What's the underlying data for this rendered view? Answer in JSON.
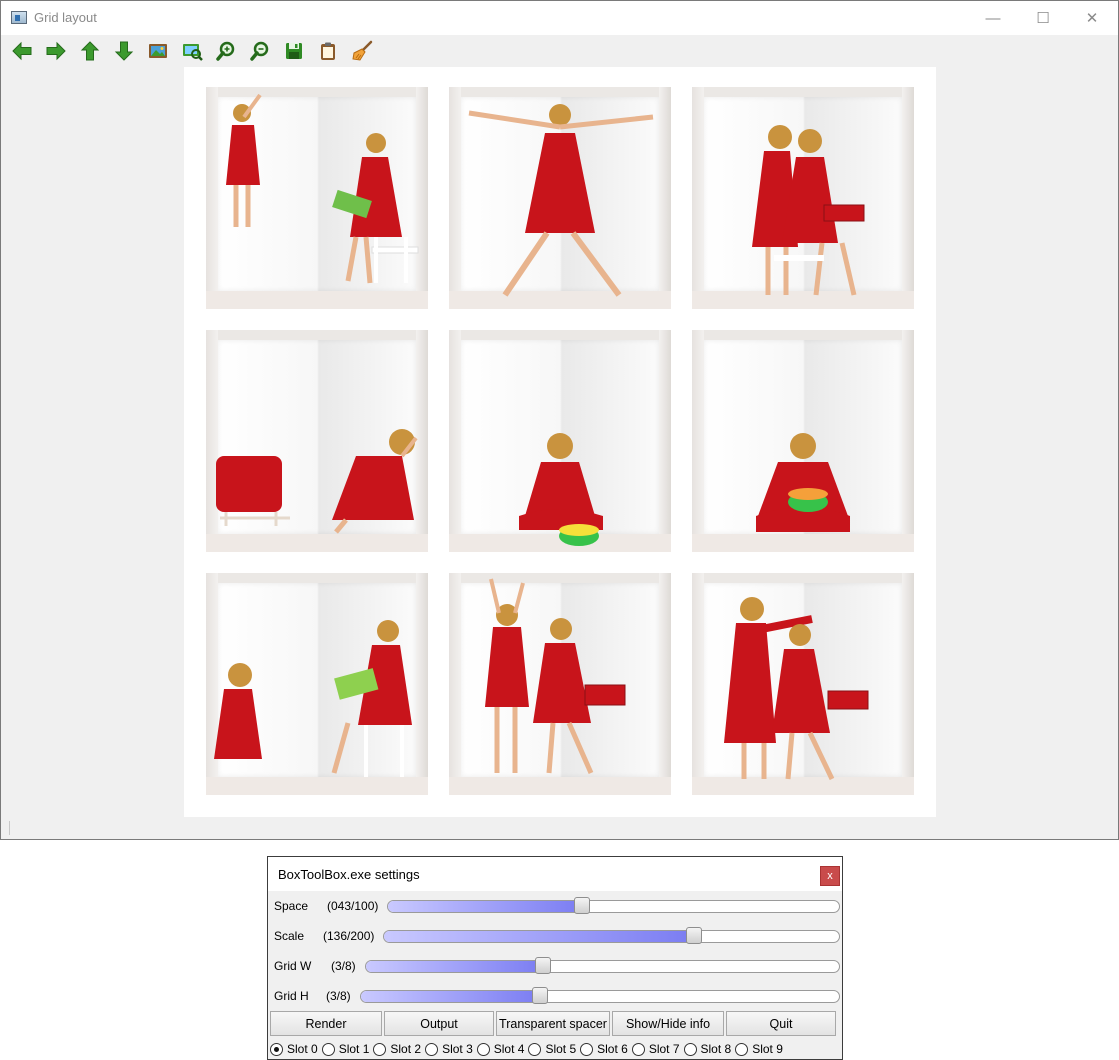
{
  "window": {
    "title": "Grid layout",
    "controls": {
      "minimize": "—",
      "maximize": "☐",
      "close": "✕"
    }
  },
  "toolbar": {
    "items": [
      {
        "name": "arrow-left-icon"
      },
      {
        "name": "arrow-right-icon"
      },
      {
        "name": "arrow-up-icon"
      },
      {
        "name": "arrow-down-icon"
      },
      {
        "name": "picture-icon"
      },
      {
        "name": "fit-picture-icon"
      },
      {
        "name": "zoom-in-icon"
      },
      {
        "name": "zoom-out-icon"
      },
      {
        "name": "save-icon"
      },
      {
        "name": "clipboard-icon"
      },
      {
        "name": "broom-icon"
      }
    ],
    "icon_color": "#3c9a2e"
  },
  "grid": {
    "rows": 3,
    "cols": 3,
    "cells": [
      {
        "name": "photo-girl-reaching-and-girl-reading"
      },
      {
        "name": "photo-girl-star-pose"
      },
      {
        "name": "photo-girls-whispering"
      },
      {
        "name": "photo-girl-crouching-by-gift"
      },
      {
        "name": "photo-girl-sitting-with-drum"
      },
      {
        "name": "photo-girl-playing-drum"
      },
      {
        "name": "photo-girl-crouching-and-girl-reading"
      },
      {
        "name": "photo-girl-climbing-and-girl-reading"
      },
      {
        "name": "photo-girl-fixing-hair-and-girl-reading"
      }
    ]
  },
  "settings": {
    "title": "BoxToolBox.exe settings",
    "close_label": "x",
    "sliders": [
      {
        "label": "Space",
        "value_text": "(043/100)",
        "value": 43,
        "max": 100
      },
      {
        "label": "Scale",
        "value_text": "(136/200)",
        "value": 136,
        "max": 200
      },
      {
        "label": "Grid W",
        "value_text": "(3/8)",
        "value": 3,
        "max": 8
      },
      {
        "label": "Grid H",
        "value_text": "(3/8)",
        "value": 3,
        "max": 8
      }
    ],
    "buttons": [
      "Render",
      "Output",
      "Transparent spacer",
      "Show/Hide info",
      "Quit"
    ],
    "slots": [
      "Slot 0",
      "Slot 1",
      "Slot 2",
      "Slot 3",
      "Slot 4",
      "Slot 5",
      "Slot 6",
      "Slot 7",
      "Slot 8",
      "Slot 9"
    ],
    "selected_slot": 0,
    "accent": "#7a7cf2"
  }
}
